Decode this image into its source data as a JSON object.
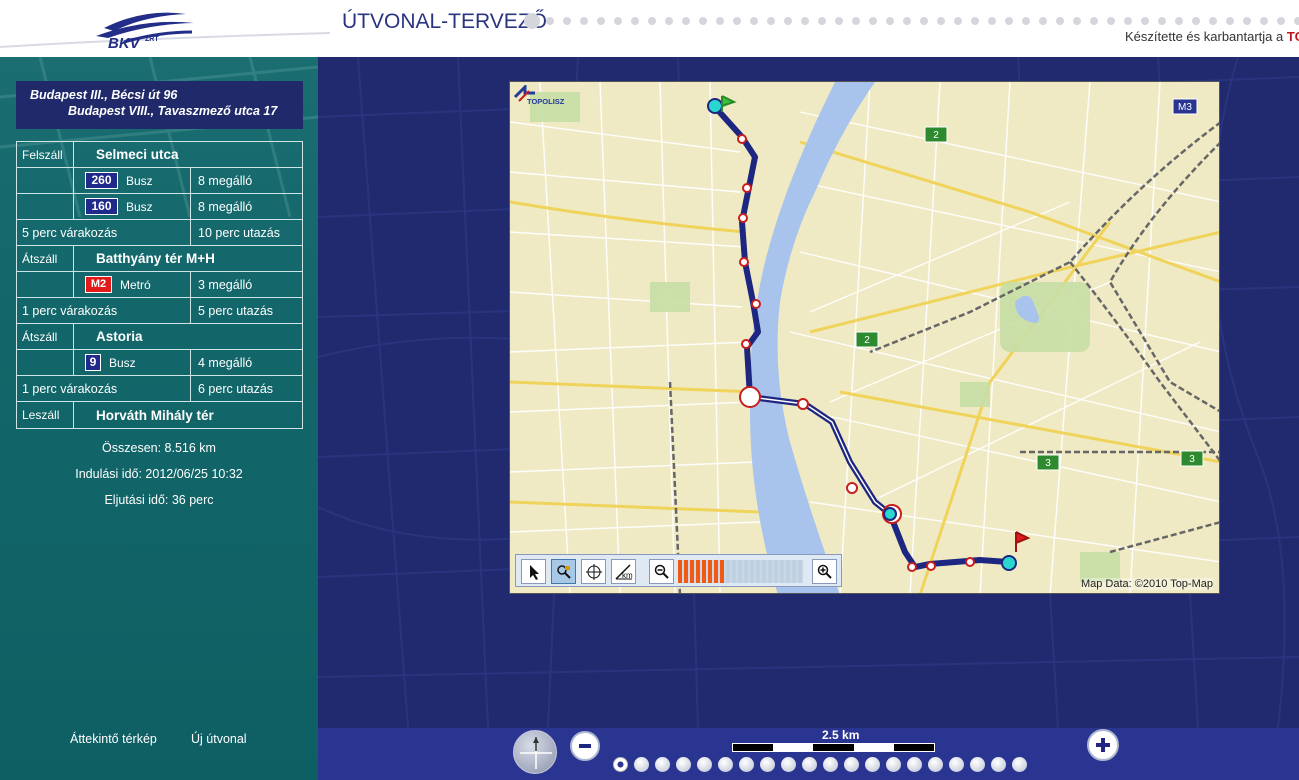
{
  "header": {
    "logo_text": "BKV",
    "logo_sup": "ZRT",
    "app_title": "ÚTVONAL-TERVEZŐ",
    "credit_text": "Készítette és karbantartja a",
    "credit_brand": "TOP"
  },
  "route": {
    "from": "Budapest III., Bécsi út 96",
    "to": "Budapest VIII., Tavaszmező utca 17",
    "segments": [
      {
        "type": "Felszáll",
        "stop": "Selmeci utca",
        "lines": [
          {
            "number": "260",
            "kind": "bus",
            "vehicle": "Busz",
            "stops": "8 megálló"
          },
          {
            "number": "160",
            "kind": "bus",
            "vehicle": "Busz",
            "stops": "8 megálló"
          }
        ],
        "wait": "5 perc várakozás",
        "travel": "10 perc utazás"
      },
      {
        "type": "Átszáll",
        "stop": "Batthyány tér M+H",
        "lines": [
          {
            "number": "M2",
            "kind": "metro",
            "vehicle": "Metró",
            "stops": "3 megálló"
          }
        ],
        "wait": "1 perc várakozás",
        "travel": "5 perc utazás"
      },
      {
        "type": "Átszáll",
        "stop": "Astoria",
        "lines": [
          {
            "number": "9",
            "kind": "bus",
            "vehicle": "Busz",
            "stops": "4 megálló"
          }
        ],
        "wait": "1 perc várakozás",
        "travel": "6 perc utazás"
      }
    ],
    "final": {
      "type": "Leszáll",
      "stop": "Horváth Mihály tér"
    }
  },
  "summary": {
    "total": "Összesen: 8.516 km",
    "departure": "Indulási idő: 2012/06/25 10:32",
    "arrival": "Eljutási idő: 36 perc"
  },
  "links": {
    "overview": "Áttekintő térkép",
    "new_route": "Új útvonal"
  },
  "map": {
    "brand": "TOPOLISZ",
    "attribution": "Map Data: ©2010 Top-Map",
    "road_labels": [
      "2",
      "2",
      "3",
      "3",
      "M3"
    ]
  },
  "bottom": {
    "scale_label": "2.5 km",
    "zoom_level_index": 0,
    "zoom_level_count": 20
  },
  "colors": {
    "primary": "#212a6e",
    "panel": "#126669",
    "route": "#1d2680",
    "river": "#a8c4ec",
    "accent_red": "#c0151b"
  }
}
